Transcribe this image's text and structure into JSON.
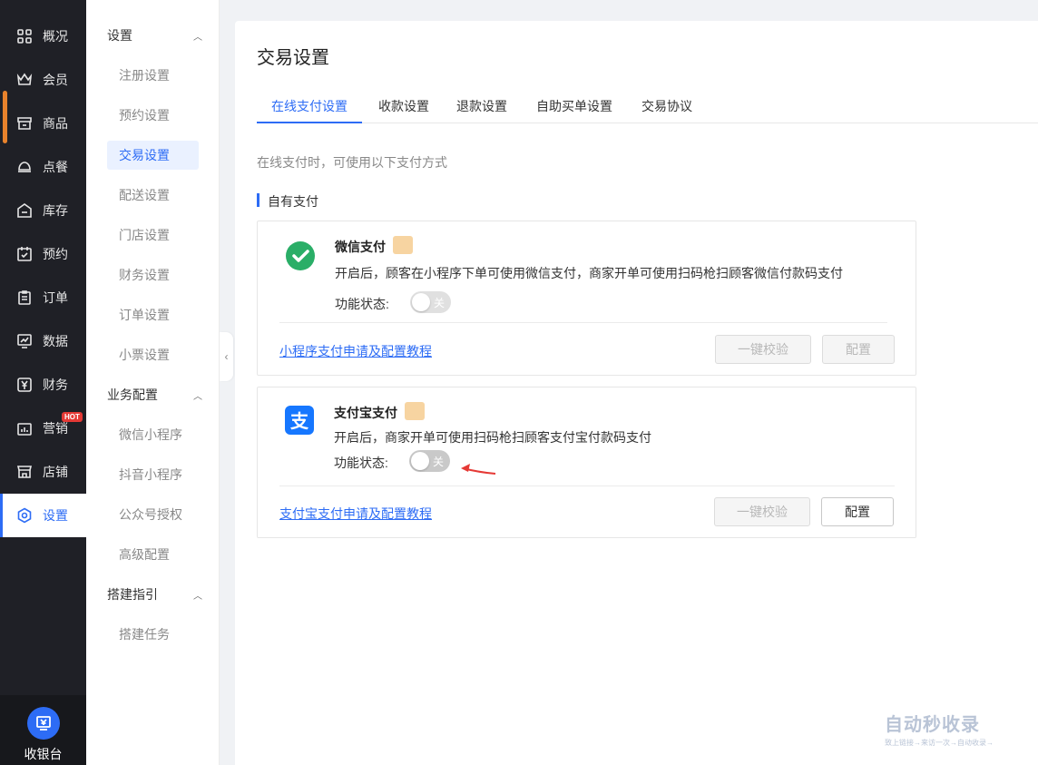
{
  "nav": {
    "items": [
      {
        "label": "概况",
        "icon": "grid-icon"
      },
      {
        "label": "会员",
        "icon": "crown-icon"
      },
      {
        "label": "商品",
        "icon": "store-icon"
      },
      {
        "label": "点餐",
        "icon": "dish-icon"
      },
      {
        "label": "库存",
        "icon": "warehouse-icon"
      },
      {
        "label": "预约",
        "icon": "calendar-check-icon"
      },
      {
        "label": "订单",
        "icon": "clipboard-icon"
      },
      {
        "label": "数据",
        "icon": "chart-icon"
      },
      {
        "label": "财务",
        "icon": "yen-icon"
      },
      {
        "label": "营销",
        "icon": "bar-chart-icon"
      },
      {
        "label": "店铺",
        "icon": "shop-icon"
      },
      {
        "label": "设置",
        "icon": "settings-icon"
      }
    ],
    "active": "设置",
    "hot_badge": "HOT",
    "cashier_label": "收银台"
  },
  "subnav": {
    "groups": [
      {
        "label": "设置",
        "items": [
          "注册设置",
          "预约设置",
          "交易设置",
          "配送设置",
          "门店设置",
          "财务设置",
          "订单设置",
          "小票设置"
        ]
      },
      {
        "label": "业务配置",
        "items": [
          "微信小程序",
          "抖音小程序",
          "公众号授权",
          "高级配置"
        ]
      },
      {
        "label": "搭建指引",
        "items": [
          "搭建任务"
        ]
      }
    ],
    "active": "交易设置"
  },
  "page": {
    "title": "交易设置",
    "tabs": [
      "在线支付设置",
      "收款设置",
      "退款设置",
      "自助买单设置",
      "交易协议"
    ],
    "active_tab": "在线支付设置",
    "description": "在线支付时，可使用以下支付方式",
    "section_title": "自有支付"
  },
  "payments": {
    "wechat": {
      "name": "微信支付",
      "description": "开启后，顾客在小程序下单可使用微信支付，商家开单可使用扫码枪扫顾客微信付款码支付",
      "status_label": "功能状态:",
      "switch_text": "关",
      "link": "小程序支付申请及配置教程",
      "verify_button": "一键校验",
      "config_button": "配置",
      "brand_color": "#2aae67"
    },
    "alipay": {
      "name": "支付宝支付",
      "description": "开启后，商家开单可使用扫码枪扫顾客支付宝付款码支付",
      "status_label": "功能状态:",
      "switch_text": "关",
      "link": "支付宝支付申请及配置教程",
      "verify_button": "一键校验",
      "config_button": "配置",
      "brand_color": "#1677ff"
    }
  },
  "watermark": {
    "main": "自动秒收录",
    "sub": "致上链接→来访一次→自动收录→"
  },
  "colors": {
    "accent": "#2d6cf5",
    "nav_bg": "#1f2026",
    "annotation_arrow": "#e53935"
  }
}
